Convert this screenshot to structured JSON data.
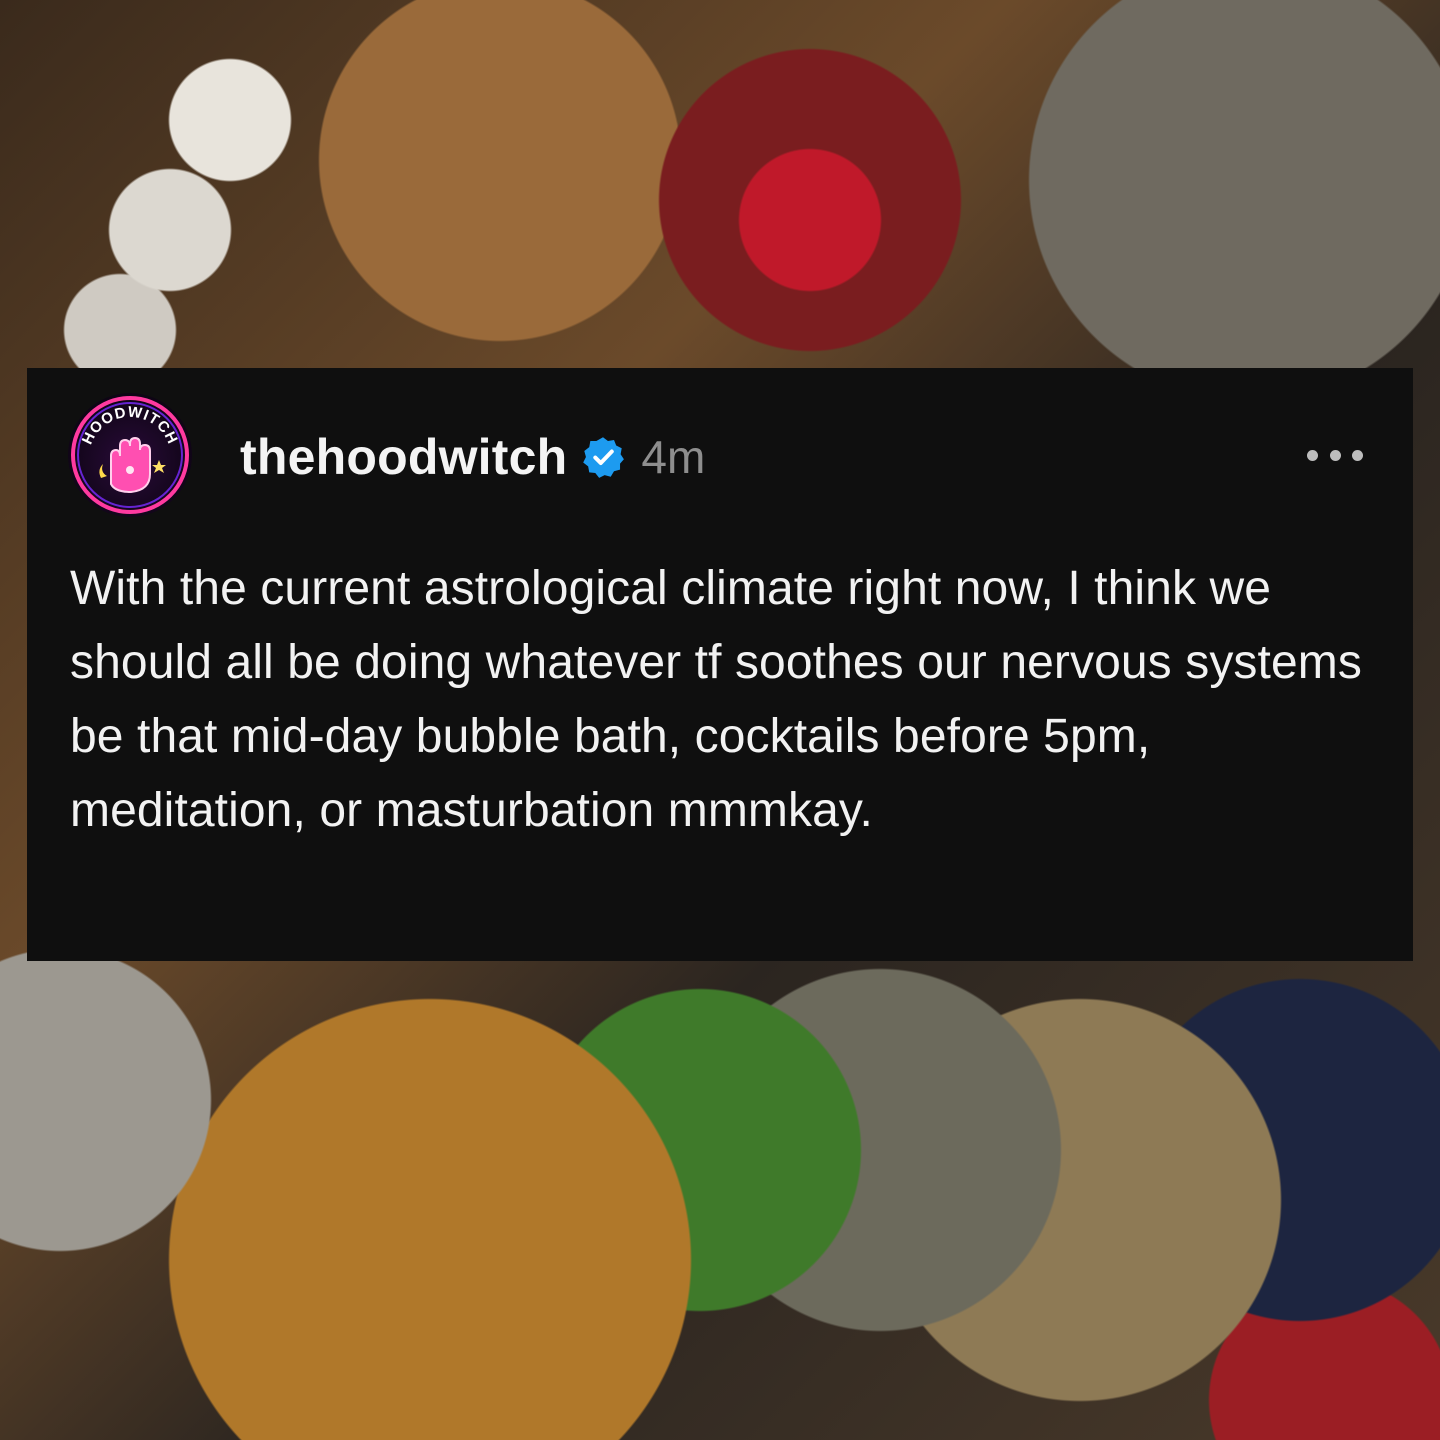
{
  "post": {
    "username": "thehoodwitch",
    "timestamp": "4m",
    "verified": true,
    "text": "With the current astrological climate right now, I think we should all be doing whatever tf soothes our nervous systems be that mid-day bubble bath, cocktails before 5pm, meditation, or masturbation mmmkay.",
    "avatar_text": "HOODWITCH"
  },
  "icons": {
    "verified": "verified-badge-icon",
    "more": "more-options-icon"
  },
  "colors": {
    "card_background": "#0f0f0f",
    "verified_blue": "#1d9bf0",
    "text": "#f2f2f2",
    "timestamp": "#8e8e8e"
  }
}
